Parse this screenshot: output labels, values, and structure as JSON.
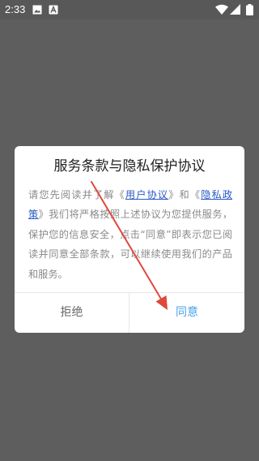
{
  "status_bar": {
    "time": "2:33",
    "icons": [
      "image-icon",
      "app-a-icon",
      "wifi-icon",
      "cellular-signal-icon",
      "battery-icon"
    ]
  },
  "dialog": {
    "title": "服务条款与隐私保护协议",
    "body": {
      "intro": "请您先阅读并了解",
      "open_quote_1": "《",
      "link_user_agreement": "用户协议",
      "close_quote_1": "》",
      "conjunction": "和",
      "open_quote_2": "《",
      "link_privacy_policy": "隐私政策",
      "close_quote_2": "》",
      "rest": "我们将严格按照上述协议为您提供服务，保护您的信息安全，点击“同意”即表示您已阅读并同意全部条款，可以继续使用我们的产品和服务。"
    },
    "buttons": {
      "reject": "拒绝",
      "agree": "同意"
    }
  },
  "colors": {
    "overlay": "#5e5e5e",
    "link": "#2a58c8",
    "agree_button": "#4aa3e8",
    "annotation_arrow": "#e0473c"
  }
}
